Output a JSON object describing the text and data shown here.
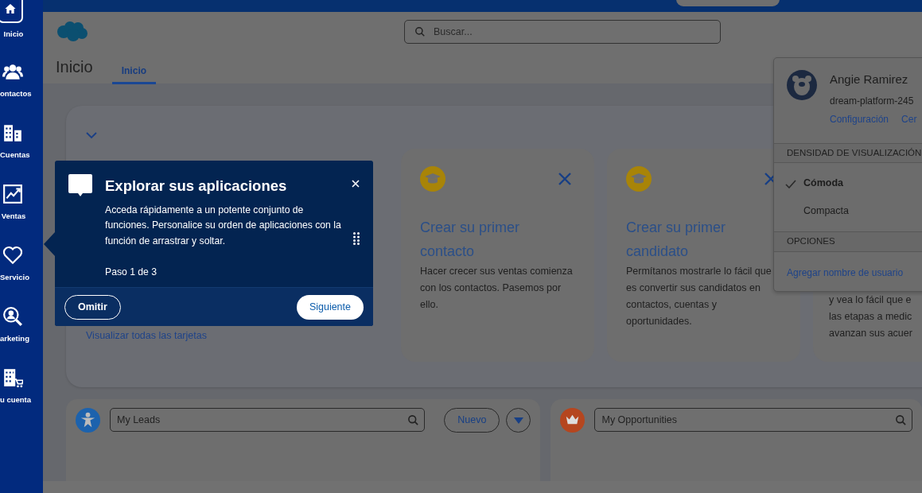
{
  "sidebar": {
    "items": [
      {
        "label": "Inicio",
        "selected": true
      },
      {
        "label": "ontactos",
        "selected": false
      },
      {
        "label": "Cuentas",
        "selected": false
      },
      {
        "label": "Ventas",
        "selected": false
      },
      {
        "label": "Servicio",
        "selected": false
      },
      {
        "label": "arketing",
        "selected": false
      },
      {
        "label": "u cuenta",
        "selected": false
      }
    ]
  },
  "search": {
    "placeholder": "Buscar..."
  },
  "page": {
    "title": "Inicio",
    "tabs": [
      {
        "label": "Inicio",
        "selected": true
      }
    ]
  },
  "tip_cards": [
    {
      "title": "Crear su primer contacto",
      "body": "Hacer crecer sus ventas comienza con los contactos. Pasemos por ello."
    },
    {
      "title": "Crear su primer candidato",
      "body": "Permítanos mostrarle lo fácil que es convertir sus candidatos en contactos, cuentas y oportunidades."
    },
    {
      "body_lines": [
        "y vea lo fácil que e",
        "las etapas a medic",
        "avanzan sus acuer"
      ]
    }
  ],
  "view_all_link": "Visualizar todas las tarjetas",
  "list_cards": [
    {
      "value": "My Leads",
      "color": "#1c62ad",
      "new_button": "Nuevo"
    },
    {
      "value": "My Opportunities",
      "color": "#b5461f"
    }
  ],
  "walkthrough": {
    "title": "Explorar sus aplicaciones",
    "body": "Acceda rápidamente a un potente conjunto de funciones. Personalice su orden de aplicaciones con la función de arrastrar y soltar.",
    "step": "Paso 1 de 3",
    "skip": "Omitir",
    "next": "Siguiente"
  },
  "user_menu": {
    "name": "Angie Ramirez",
    "org": "dream-platform-245",
    "links": [
      "Configuración",
      "Cer"
    ],
    "density_header": "DENSIDAD DE VISUALIZACIÓN",
    "density_options": [
      {
        "label": "Cómoda",
        "selected": true
      },
      {
        "label": "Compacta",
        "selected": false
      }
    ],
    "options_header": "OPCIONES",
    "options_links": [
      "Agregar nombre de usuario"
    ]
  }
}
